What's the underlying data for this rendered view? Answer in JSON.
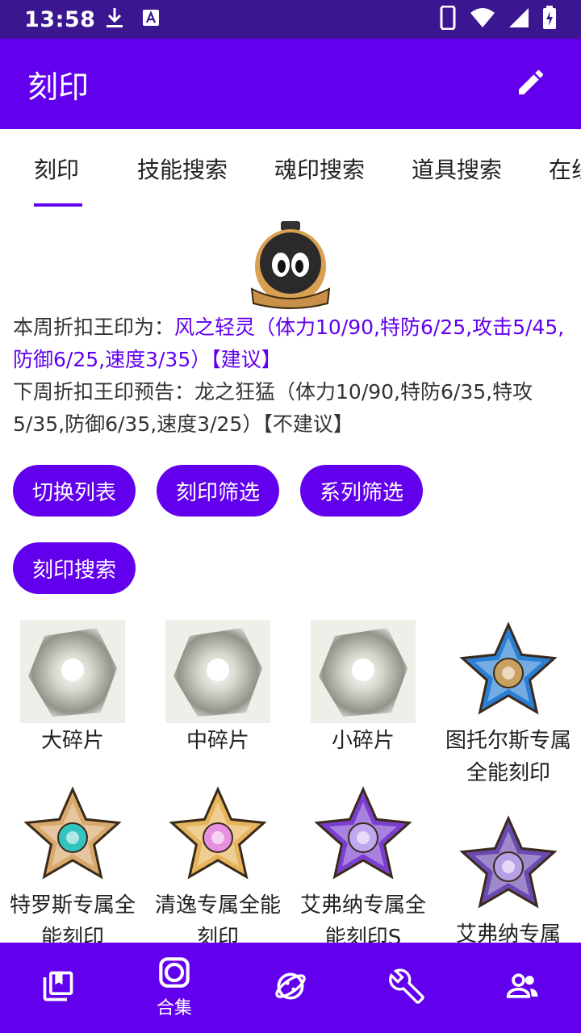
{
  "status_bar": {
    "time": "13:58",
    "icons": [
      "download-icon",
      "font-a-icon",
      "phone-vibrate-icon",
      "wifi-icon",
      "signal-icon",
      "battery-charging-icon"
    ]
  },
  "app_bar": {
    "title": "刻印",
    "edit_icon": "edit-pencil-icon"
  },
  "tabs": [
    {
      "label": "刻印",
      "active": true
    },
    {
      "label": "技能搜索"
    },
    {
      "label": "魂印搜索"
    },
    {
      "label": "道具搜索"
    },
    {
      "label": "在线"
    }
  ],
  "info": {
    "this_week_prefix": "本周折扣王印为：",
    "this_week_value": "风之轻灵（体力10/90,特防6/25,攻击5/45,防御6/25,速度3/35）【建议】",
    "next_week": "下周折扣王印预告：龙之狂猛（体力10/90,特防6/35,特攻5/35,防御6/35,速度3/25）【不建议】"
  },
  "chips": {
    "switch_list": "切换列表",
    "mark_filter": "刻印筛选",
    "series_filter": "系列筛选",
    "mark_search": "刻印搜索"
  },
  "items": [
    {
      "label": "大碎片",
      "kind": "fragment"
    },
    {
      "label": "中碎片",
      "kind": "fragment"
    },
    {
      "label": "小碎片",
      "kind": "fragment"
    },
    {
      "label": "图托尔斯专属全能刻印",
      "kind": "star",
      "color": "#2a7fd4",
      "core": "#c8a060"
    },
    {
      "label": "特罗斯专属全能刻印",
      "kind": "star",
      "color": "#d9a86c",
      "core": "#33c4c0"
    },
    {
      "label": "清逸专属全能刻印",
      "kind": "star",
      "color": "#e6b45a",
      "core": "#e890e0"
    },
    {
      "label": "艾弗纳专属全能刻印S",
      "kind": "star",
      "color": "#7b3fd0",
      "core": "#c0a8f0"
    },
    {
      "label": "艾弗纳专属",
      "kind": "star",
      "color": "#6a4ab0",
      "core": "#b8a0e8"
    }
  ],
  "bottom_nav": [
    {
      "icon": "book-icon",
      "label": ""
    },
    {
      "icon": "collection-icon",
      "label": "合集",
      "active": true
    },
    {
      "icon": "planet-icon",
      "label": ""
    },
    {
      "icon": "wrench-icon",
      "label": ""
    },
    {
      "icon": "people-icon",
      "label": ""
    }
  ],
  "colors": {
    "primary": "#6200ee",
    "status_bar": "#3a1690"
  }
}
